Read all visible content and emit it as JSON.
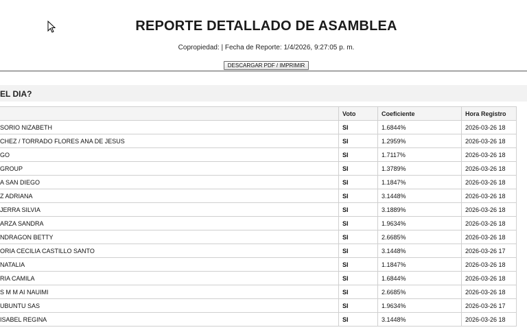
{
  "report": {
    "title": "REPORTE DETALLADO DE ASAMBLEA",
    "subline": "Copropiedad: | Fecha de Reporte: 1/4/2026, 9:27:05 p. m.",
    "print_button": "DESCARGAR PDF / IMPRIMIR"
  },
  "section": {
    "title": "EL DIA?"
  },
  "table": {
    "headers": {
      "name": "",
      "voto": "Voto",
      "coeficiente": "Coeficiente",
      "hora": "Hora Registro"
    },
    "rows": [
      {
        "name": "SORIO NIZABETH",
        "voto": "SI",
        "coeficiente": "1.6844%",
        "hora": "2026-03-26 18"
      },
      {
        "name": "CHEZ / TORRADO FLORES ANA DE JESUS",
        "voto": "SI",
        "coeficiente": "1.2959%",
        "hora": "2026-03-26 18"
      },
      {
        "name": "GO",
        "voto": "SI",
        "coeficiente": "1.7117%",
        "hora": "2026-03-26 18"
      },
      {
        "name": "GROUP",
        "voto": "SI",
        "coeficiente": "1.3789%",
        "hora": "2026-03-26 18"
      },
      {
        "name": "A SAN DIEGO",
        "voto": "SI",
        "coeficiente": "1.1847%",
        "hora": "2026-03-26 18"
      },
      {
        "name": "Z ADRIANA",
        "voto": "SI",
        "coeficiente": "3.1448%",
        "hora": "2026-03-26 18"
      },
      {
        "name": "JERRA SILVIA",
        "voto": "SI",
        "coeficiente": "3.1889%",
        "hora": "2026-03-26 18"
      },
      {
        "name": "ARZA SANDRA",
        "voto": "SI",
        "coeficiente": "1.9634%",
        "hora": "2026-03-26 18"
      },
      {
        "name": "NDRAGON BETTY",
        "voto": "SI",
        "coeficiente": "2.6685%",
        "hora": "2026-03-26 18"
      },
      {
        "name": "ORIA CECILIA CASTILLO SANTO",
        "voto": "SI",
        "coeficiente": "3.1448%",
        "hora": "2026-03-26 17"
      },
      {
        "name": "NATALIA",
        "voto": "SI",
        "coeficiente": "1.1847%",
        "hora": "2026-03-26 18"
      },
      {
        "name": "RIA CAMILA",
        "voto": "SI",
        "coeficiente": "1.6844%",
        "hora": "2026-03-26 18"
      },
      {
        "name": "S M M AI NAUIMI",
        "voto": "SI",
        "coeficiente": "2.6685%",
        "hora": "2026-03-26 18"
      },
      {
        "name": "UBUNTU SAS",
        "voto": "SI",
        "coeficiente": "1.9634%",
        "hora": "2026-03-26 17"
      },
      {
        "name": "ISABEL REGINA",
        "voto": "SI",
        "coeficiente": "3.1448%",
        "hora": "2026-03-26 18"
      }
    ]
  },
  "icons": {
    "cursor": "mouse-pointer-icon"
  },
  "colors": {
    "header_bg": "#f4f4f4",
    "section_bg": "#f2f2f2",
    "border": "#cfcfcf"
  }
}
